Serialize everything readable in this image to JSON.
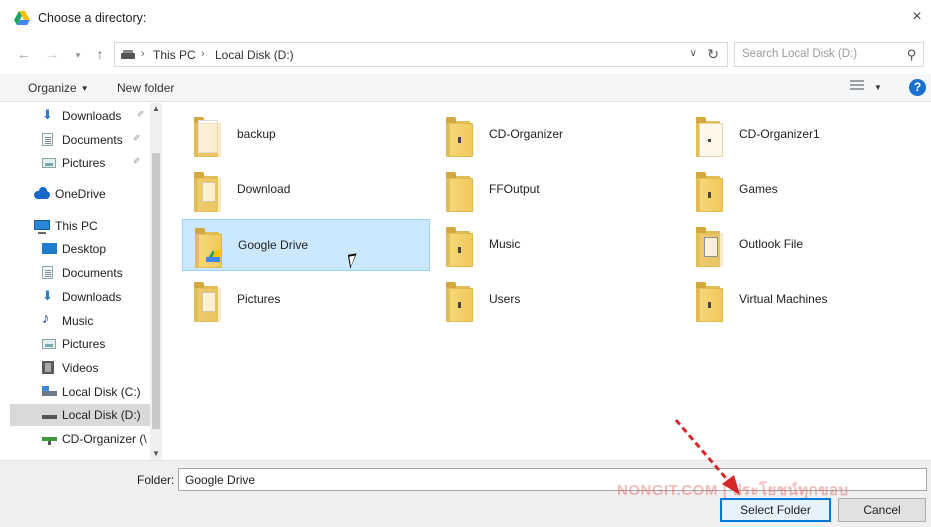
{
  "window": {
    "title": "Choose a directory:",
    "close_glyph": "×"
  },
  "address": {
    "back_glyph": "←",
    "forward_glyph": "→",
    "recent_glyph": "▾",
    "up_glyph": "↑",
    "crumbs": [
      "This PC",
      "Local Disk (D:)"
    ],
    "crumb_separator": "›",
    "dropdown_glyph": "∨",
    "refresh_glyph": "↻",
    "search_placeholder": "Search Local Disk (D:)",
    "search_glyph": "⚲"
  },
  "toolbar": {
    "organize_label": "Organize",
    "organize_caret": "▼",
    "new_folder_label": "New folder",
    "view_caret": "▼",
    "help_glyph": "?"
  },
  "nav": {
    "pin_glyph": "✐",
    "items": [
      {
        "label": "Downloads",
        "icon": "download-icon",
        "pinned": true
      },
      {
        "label": "Documents",
        "icon": "document-icon",
        "pinned": true
      },
      {
        "label": "Pictures",
        "icon": "pictures-icon",
        "pinned": true
      },
      {
        "label": "OneDrive",
        "icon": "onedrive-icon"
      },
      {
        "label": "This PC",
        "icon": "pc-icon"
      },
      {
        "label": "Desktop",
        "icon": "desktop-icon"
      },
      {
        "label": "Documents",
        "icon": "document-icon"
      },
      {
        "label": "Downloads",
        "icon": "download-icon"
      },
      {
        "label": "Music",
        "icon": "music-icon"
      },
      {
        "label": "Pictures",
        "icon": "pictures-icon"
      },
      {
        "label": "Videos",
        "icon": "videos-icon"
      },
      {
        "label": "Local Disk (C:)",
        "icon": "drive-c-icon"
      },
      {
        "label": "Local Disk (D:)",
        "icon": "drive-d-icon",
        "selected": true
      },
      {
        "label": "CD-Organizer (\\",
        "icon": "network-drive-icon"
      }
    ],
    "scroll_up_glyph": "▲",
    "scroll_down_glyph": "▼"
  },
  "folders": [
    {
      "name": "backup",
      "style": "page"
    },
    {
      "name": "CD-Organizer",
      "style": "marked"
    },
    {
      "name": "CD-Organizer1",
      "style": "dot"
    },
    {
      "name": "Download",
      "style": "doc"
    },
    {
      "name": "FFOutput",
      "style": "plain"
    },
    {
      "name": "Games",
      "style": "marked"
    },
    {
      "name": "Google Drive",
      "style": "gdrive",
      "selected": true
    },
    {
      "name": "Music",
      "style": "marked"
    },
    {
      "name": "Outlook File",
      "style": "doc"
    },
    {
      "name": "Pictures",
      "style": "doc"
    },
    {
      "name": "Users",
      "style": "marked"
    },
    {
      "name": "Virtual Machines",
      "style": "marked"
    }
  ],
  "bottom": {
    "folder_label": "Folder:",
    "folder_value": "Google Drive",
    "select_button": "Select Folder",
    "cancel_button": "Cancel",
    "watermark": "NONGIT.COM | ประโยชน์ทุกขอบ"
  },
  "colors": {
    "selection_bg": "#cce8ff",
    "selection_border": "#99d1ff",
    "accent": "#0078d7",
    "arrow": "#d62828"
  }
}
